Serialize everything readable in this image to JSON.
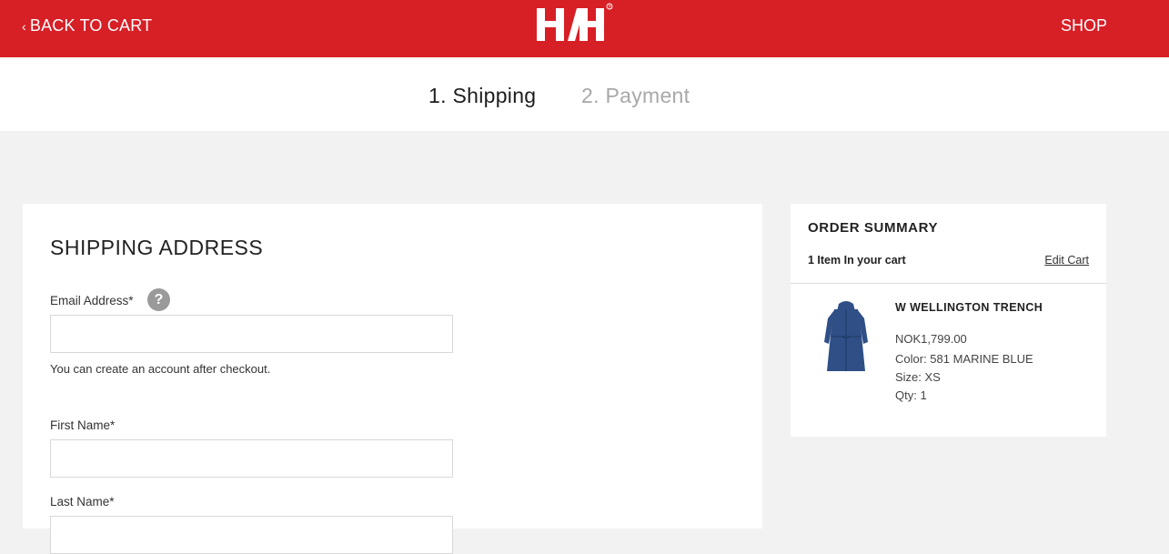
{
  "header": {
    "back_label": "BACK TO CART",
    "logo_text": "HH",
    "shop_label": "SHOP",
    "brand_color": "#d71f26"
  },
  "steps": [
    {
      "label": "1. Shipping",
      "active": true
    },
    {
      "label": "2. Payment",
      "active": false
    }
  ],
  "shipping": {
    "title": "SHIPPING ADDRESS",
    "email_label": "Email Address*",
    "help_icon": "?",
    "email_value": "",
    "email_hint": "You can create an account after checkout.",
    "first_name_label": "First Name*",
    "first_name_value": "",
    "last_name_label": "Last Name*",
    "last_name_value": ""
  },
  "summary": {
    "title": "ORDER SUMMARY",
    "item_count": "1 Item In your cart",
    "edit_label": "Edit Cart",
    "product": {
      "name": "W WELLINGTON TRENCH",
      "price": "NOK1,799.00",
      "color": "Color: 581 MARINE BLUE",
      "size": "Size: XS",
      "qty": "Qty: 1",
      "image_color": "#2f4f86"
    }
  }
}
